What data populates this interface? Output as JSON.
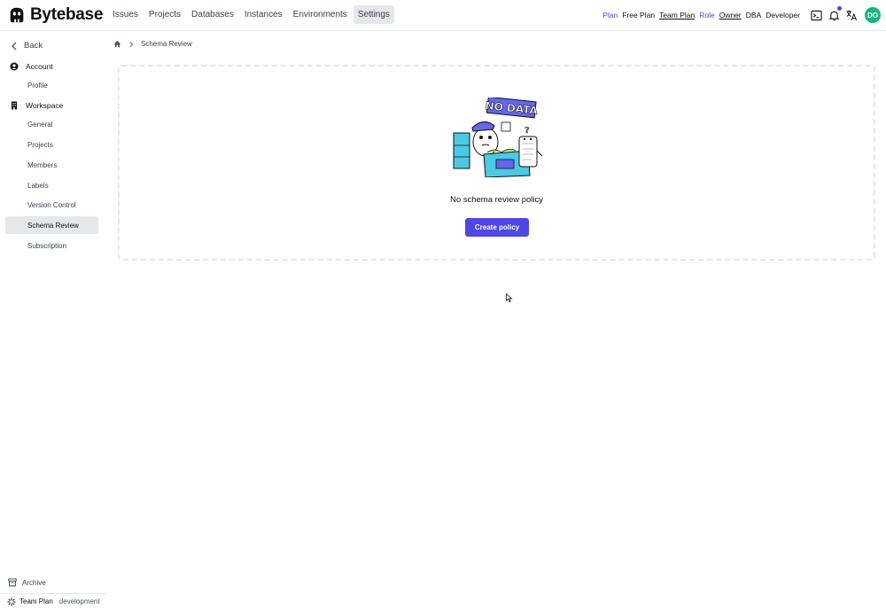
{
  "app": {
    "name": "Bytebase"
  },
  "nav": {
    "items": [
      {
        "label": "Issues"
      },
      {
        "label": "Projects"
      },
      {
        "label": "Databases"
      },
      {
        "label": "Instances"
      },
      {
        "label": "Environments"
      },
      {
        "label": "Settings",
        "active": true
      }
    ]
  },
  "header": {
    "plan_label": "Plan",
    "plan_free": "Free Plan",
    "plan_team": "Team Plan",
    "role_label": "Role",
    "role_owner": "Owner",
    "role_dba": "DBA",
    "role_developer": "Developer",
    "avatar_initials": "DO",
    "icons": [
      "terminal-icon",
      "bell-icon",
      "translate-icon"
    ]
  },
  "sidebar": {
    "back_label": "Back",
    "account_label": "Account",
    "profile_label": "Profile",
    "workspace_label": "Workspace",
    "items": [
      {
        "label": "General"
      },
      {
        "label": "Projects"
      },
      {
        "label": "Members"
      },
      {
        "label": "Labels"
      },
      {
        "label": "Version Control"
      },
      {
        "label": "Schema Review",
        "active": true
      },
      {
        "label": "Subscription"
      }
    ],
    "archive_label": "Archive",
    "footer_plan": "Team Plan",
    "footer_env": "development"
  },
  "breadcrumb": {
    "current": "Schema Review"
  },
  "empty_state": {
    "illustration_text": "NO DATA",
    "message": "No schema review policy",
    "button_label": "Create policy"
  },
  "colors": {
    "accent": "#4f46e5",
    "avatar_bg": "#15b77e",
    "active_bg": "#e5e7eb"
  }
}
